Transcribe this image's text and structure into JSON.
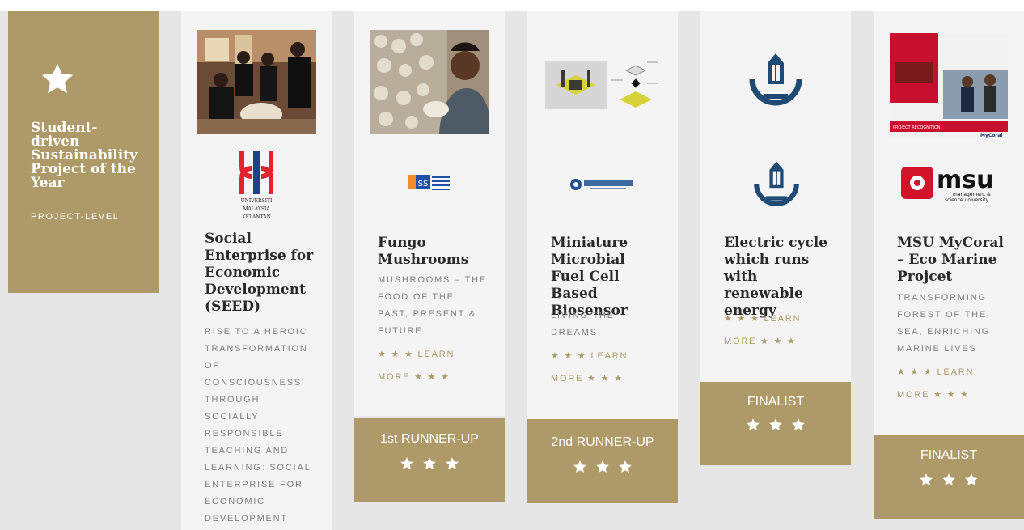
{
  "category": {
    "title": "Student-driven Sustainability Project of the Year",
    "level": "PROJECT-LEVEL"
  },
  "projects": [
    {
      "title": "Social Enterprise for Economic Development (SEED)",
      "subtitle": "RISE TO A HEROIC TRANSFORMATION OF CONSCIOUSNESS THROUGH SOCIALLY RESPONSIBLE TEACHING AND LEARNING: SOCIAL ENTERPRISE FOR ECONOMIC DEVELOPMENT",
      "logo_text": [
        "UNIVERSITI",
        "MALAYSIA",
        "KELANTAN"
      ]
    },
    {
      "title": "Fungo Mushrooms",
      "subtitle": "MUSHROOMS – THE FOOD OF THE PAST, PRESENT & FUTURE",
      "learn_more": "★ ★ ★ LEARN MORE ★ ★ ★",
      "award": "1st RUNNER-UP"
    },
    {
      "title": "Miniature Microbial Fuel Cell Based Biosensor",
      "subtitle": "LIVING THE DREAMS",
      "learn_more": "★ ★ ★ LEARN MORE ★ ★ ★",
      "award": "2nd RUNNER-UP"
    },
    {
      "title": "Electric cycle which runs with renewable energy",
      "learn_more": "★ ★ ★ LEARN MORE ★ ★ ★",
      "award": "FINALIST"
    },
    {
      "title": "MSU MyCoral – Eco Marine Projcet",
      "subtitle": "TRANSFORMING FOREST OF THE SEA, ENRICHING MARINE LIVES",
      "learn_more": "★ ★ ★ LEARN MORE ★ ★ ★",
      "award": "FINALIST",
      "logo_text": [
        "msu",
        "management &",
        "science university"
      ],
      "poster_text": [
        "PROJECT RECOGNITION",
        "MyCoral"
      ]
    }
  ],
  "colors": {
    "accent": "#ad9a68",
    "card_bg": "#f4f4f4",
    "page_bg": "#e6e6e6"
  }
}
